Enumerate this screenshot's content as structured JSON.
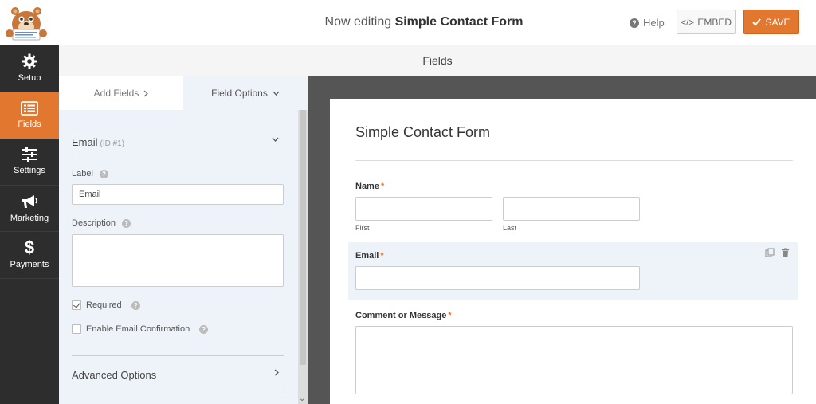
{
  "header": {
    "title_prefix": "Now editing ",
    "form_name": "Simple Contact Form",
    "help_label": "Help",
    "embed_label": "EMBED",
    "save_label": "SAVE",
    "accent_color": "#e27730"
  },
  "sidebar": {
    "items": [
      {
        "label": "Setup",
        "icon": "gear-icon"
      },
      {
        "label": "Fields",
        "icon": "fields-list-icon",
        "active": true
      },
      {
        "label": "Settings",
        "icon": "sliders-icon"
      },
      {
        "label": "Marketing",
        "icon": "megaphone-icon"
      },
      {
        "label": "Payments",
        "icon": "dollar-icon"
      }
    ]
  },
  "section": {
    "title": "Fields"
  },
  "panel": {
    "tabs": {
      "add_fields": "Add Fields",
      "field_options": "Field Options"
    },
    "field": {
      "name": "Email",
      "id_text": "(ID #1)",
      "label_caption": "Label",
      "label_value": "Email",
      "description_caption": "Description",
      "description_value": "",
      "required_label": "Required",
      "required_checked": true,
      "confirmation_label": "Enable Email Confirmation",
      "confirmation_checked": false,
      "advanced_label": "Advanced Options"
    }
  },
  "preview": {
    "form_title": "Simple Contact Form",
    "name_label": "Name",
    "first_sublabel": "First",
    "last_sublabel": "Last",
    "email_label": "Email",
    "message_label": "Comment or Message",
    "required_mark": "*"
  }
}
